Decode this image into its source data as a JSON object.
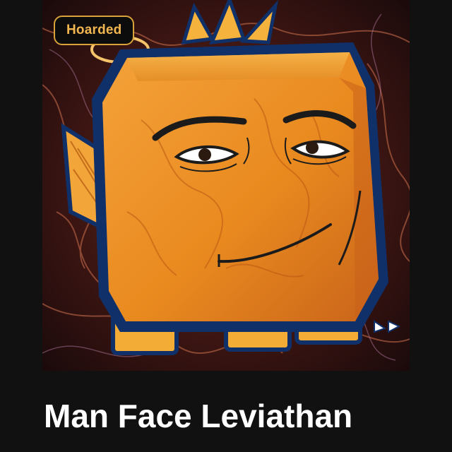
{
  "item": {
    "badge": "Hoarded",
    "title": "Man Face Leviathan",
    "image_subject": "orange block-headed Leviathan pet with a smirking man face on a dark lava-marble background"
  },
  "colors": {
    "background": "#111112",
    "badge_border": "#d9a23a",
    "badge_text": "#f1b650",
    "title_text": "#ffffff",
    "head_orange": "#e9861c",
    "outline_navy": "#10306a"
  },
  "icons": {
    "head": "man-face-leviathan-icon"
  }
}
